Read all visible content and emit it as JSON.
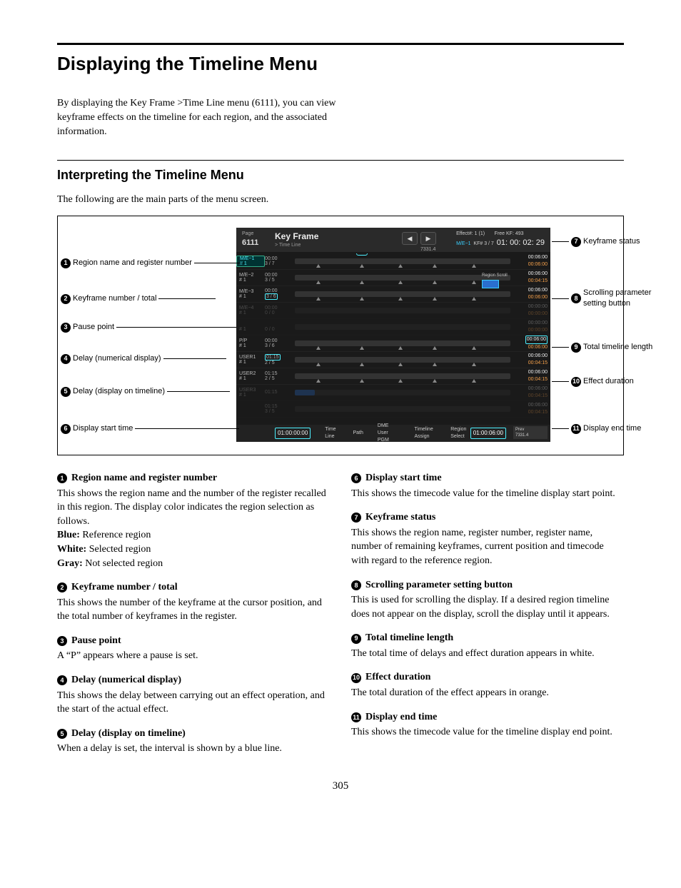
{
  "page_number": "305",
  "h1": "Displaying the Timeline Menu",
  "intro": "By displaying the Key Frame >Time Line menu (6111), you can view keyframe effects on the timeline for each region, and the associated information.",
  "h2": "Interpreting the Timeline Menu",
  "lead": "The following are the main parts of the menu screen.",
  "panel": {
    "page_label": "Page",
    "page_num": "6111",
    "title": "Key Frame",
    "breadcrumb": "> Time Line",
    "sub_num": "7331.4",
    "status_line1": "Effect#: 1 (1)",
    "status_line2_left": "M/E−1",
    "status_line2_right": "KF# 3 / 7",
    "free_kf": "Free KF: 493",
    "timecode": "01: 00: 02: 29",
    "scroll_label": "Region Scroll",
    "start_tc": "01:00:00:00",
    "end_tc": "01:00:06:00",
    "footer_btns": [
      "Time Line",
      "Path",
      "DME User PGM",
      "Timeline Assign",
      "Region Select"
    ],
    "prev_label": "Prev",
    "prev_val": "7331.4",
    "pause_badge": "P",
    "tracks": [
      {
        "label": "M/E−1",
        "sub": "# 1",
        "blue": true,
        "time": "00:00",
        "ratio": "3 / 7",
        "end_w": "00:06:00",
        "end_o": "00:06:00",
        "boxed_ratio": false,
        "boxed_end": false
      },
      {
        "label": "M/E−2",
        "sub": "# 1",
        "time": "00:00",
        "ratio": "3 / 5",
        "end_w": "00:06:00",
        "end_o": "00:04:15",
        "boxed_ratio": false,
        "boxed_end": false
      },
      {
        "label": "M/E−3",
        "sub": "# 1",
        "time": "00:00",
        "ratio": "3 / 6",
        "end_w": "00:06:00",
        "end_o": "00:06:00",
        "boxed_ratio": true,
        "boxed_end": false
      },
      {
        "label": "M/E−4",
        "sub": "# 1",
        "dim": true,
        "time": "00:00",
        "ratio": "0 / 0",
        "end_w": "00:00:00",
        "end_o": "00:00:00"
      },
      {
        "label": "",
        "sub": "# 1",
        "dim": true,
        "time": "",
        "ratio": "0 / 0",
        "end_w": "00:00:00",
        "end_o": "00:00:00"
      },
      {
        "label": "P/P",
        "sub": "# 1",
        "time": "00:00",
        "ratio": "3 / 6",
        "end_w": "00:06:00",
        "end_o": "00:06:00",
        "boxed_end": true
      },
      {
        "label": "USER1",
        "sub": "# 1",
        "time": "01:15",
        "ratio": "2 / 5",
        "end_w": "00:06:00",
        "end_o": "00:04:15",
        "boxed_time": true
      },
      {
        "label": "USER2",
        "sub": "# 1",
        "time": "01:15",
        "ratio": "2 / 5",
        "end_w": "00:06:00",
        "end_o": "00:04:15"
      },
      {
        "label": "USER3",
        "sub": "# 1",
        "dim": true,
        "time": "01:15",
        "ratio": "",
        "end_w": "00:06:00",
        "end_o": "00:04:15",
        "delay_band": true
      },
      {
        "label": "",
        "sub": "",
        "dim": true,
        "time": "01:15",
        "ratio": "3 / 5",
        "end_w": "00:06:00",
        "end_o": "00:04:15"
      }
    ]
  },
  "callouts": {
    "c1": "Region name and register number",
    "c2": "Keyframe number / total",
    "c3": "Pause point",
    "c4": "Delay (numerical display)",
    "c5": "Delay (display on timeline)",
    "c6": "Display start time",
    "c7": "Keyframe status",
    "c8": "Scrolling parameter setting button",
    "c9": "Total timeline length",
    "c10": "Effect duration",
    "c11": "Display end time"
  },
  "descriptions": [
    {
      "n": "1",
      "title": "Region name and register number",
      "body": "This shows the region name and the number of the register recalled in this region. The display color indicates the region selection as follows.",
      "extras": [
        {
          "b": "Blue:",
          "t": " Reference region"
        },
        {
          "b": "White:",
          "t": " Selected region"
        },
        {
          "b": "Gray:",
          "t": " Not selected region"
        }
      ]
    },
    {
      "n": "2",
      "title": "Keyframe number / total",
      "body": "This shows the number of the keyframe at the cursor position, and the total number of keyframes in the register."
    },
    {
      "n": "3",
      "title": "Pause point",
      "body": "A “P” appears where a pause is set."
    },
    {
      "n": "4",
      "title": "Delay (numerical display)",
      "body": "This shows the delay between carrying out an effect operation, and the start of the actual effect."
    },
    {
      "n": "5",
      "title": "Delay (display on timeline)",
      "body": "When a delay is set, the interval is shown by a blue line."
    },
    {
      "n": "6",
      "title": "Display start time",
      "body": "This shows the timecode value for the timeline display start point."
    },
    {
      "n": "7",
      "title": "Keyframe status",
      "body": "This shows the region name, register number, register name, number of remaining keyframes, current position and timecode with regard to the reference region."
    },
    {
      "n": "8",
      "title": "Scrolling parameter setting button",
      "body": "This is used for scrolling the display.\nIf a desired region timeline does not appear on the display, scroll the display until it appears."
    },
    {
      "n": "9",
      "title": "Total timeline length",
      "body": "The total time of delays and effect duration appears in white."
    },
    {
      "n": "10",
      "title": "Effect duration",
      "body": "The total duration of the effect appears in orange."
    },
    {
      "n": "11",
      "title": "Display end time",
      "body": "This shows the timecode value for the timeline display end point."
    }
  ]
}
